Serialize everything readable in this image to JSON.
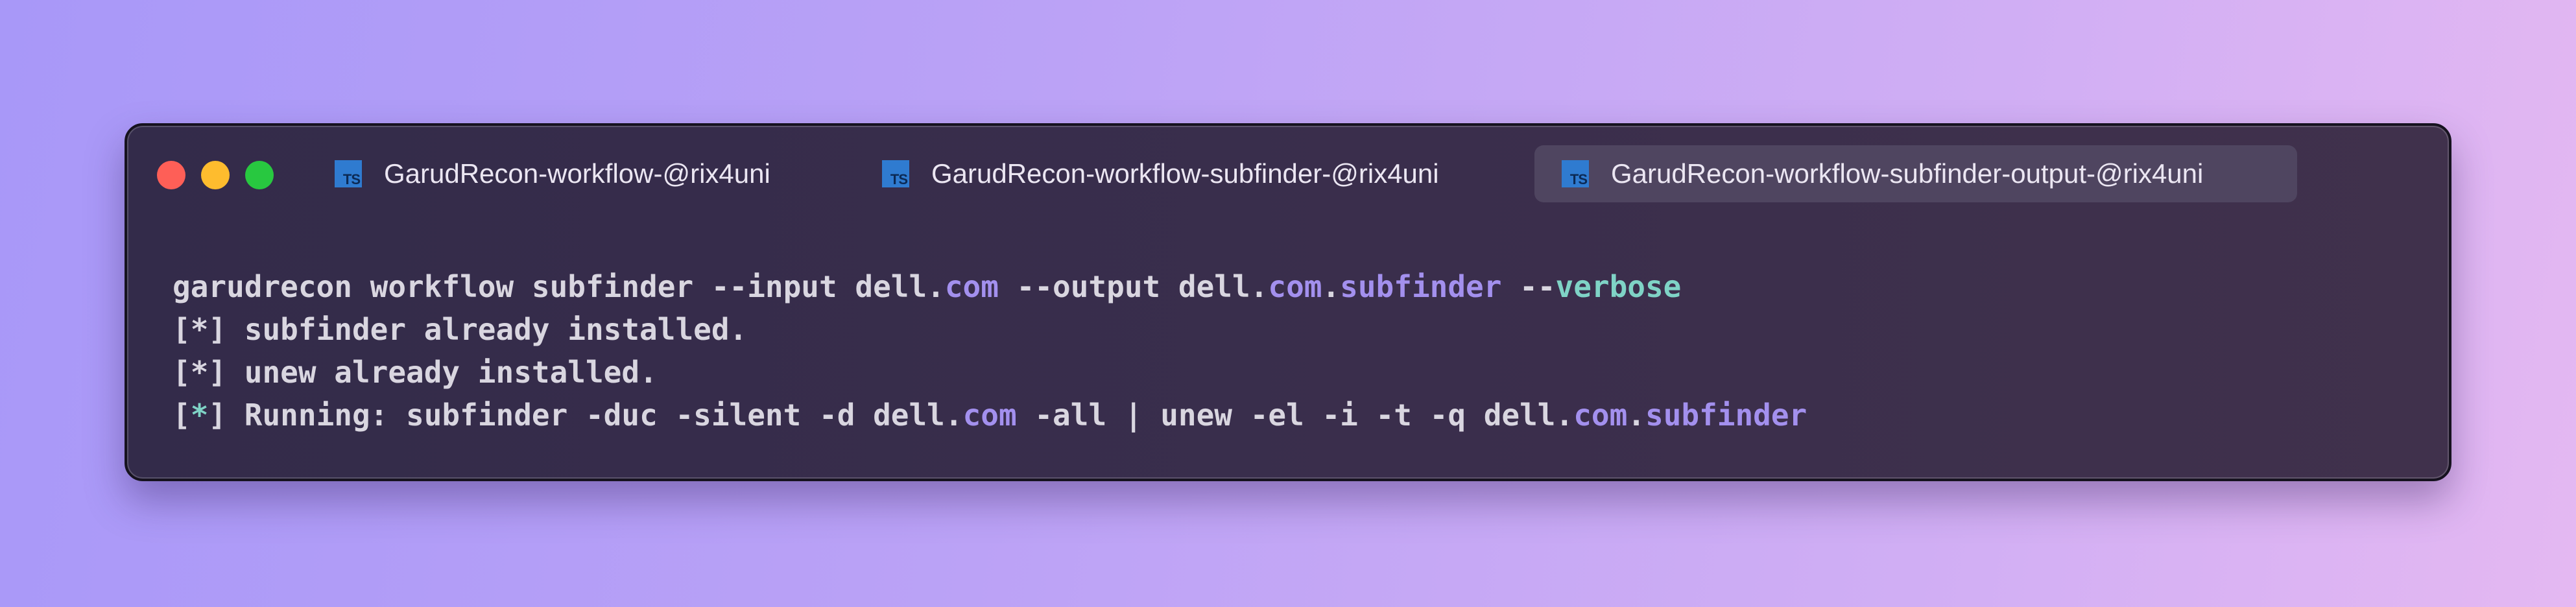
{
  "window": {
    "tabs": [
      {
        "label": "GarudRecon-workflow-@rix4uni",
        "icon": "typescript-icon",
        "icon_text": "TS",
        "active": false
      },
      {
        "label": "GarudRecon-workflow-subfinder-@rix4uni",
        "icon": "typescript-icon",
        "icon_text": "TS",
        "active": false
      },
      {
        "label": "GarudRecon-workflow-subfinder-output-@rix4uni",
        "icon": "typescript-icon",
        "icon_text": "TS",
        "active": true
      }
    ]
  },
  "terminal": {
    "command": {
      "p1": "garudrecon workflow subfinder --input dell.",
      "p2": "com",
      "p3": " --output dell.",
      "p4": "com",
      "p5": ".",
      "p6": "subfinder",
      "p7": " --",
      "p8": "verbose"
    },
    "line2": "[*] subfinder already installed.",
    "line3": "[*] unew already installed.",
    "line4": {
      "p1": "[",
      "p2": "*",
      "p3": "] Running: subfinder -duc -silent -d dell.",
      "p4": "com",
      "p5": " -all | unew -el -i -t -q dell.",
      "p6": "com",
      "p7": ".",
      "p8": "subfinder"
    }
  },
  "colors": {
    "accent_purple": "#a390ee",
    "accent_teal": "#7fd3c6",
    "close": "#fe5f57",
    "minimize": "#febc2e",
    "maximize": "#28c840"
  }
}
